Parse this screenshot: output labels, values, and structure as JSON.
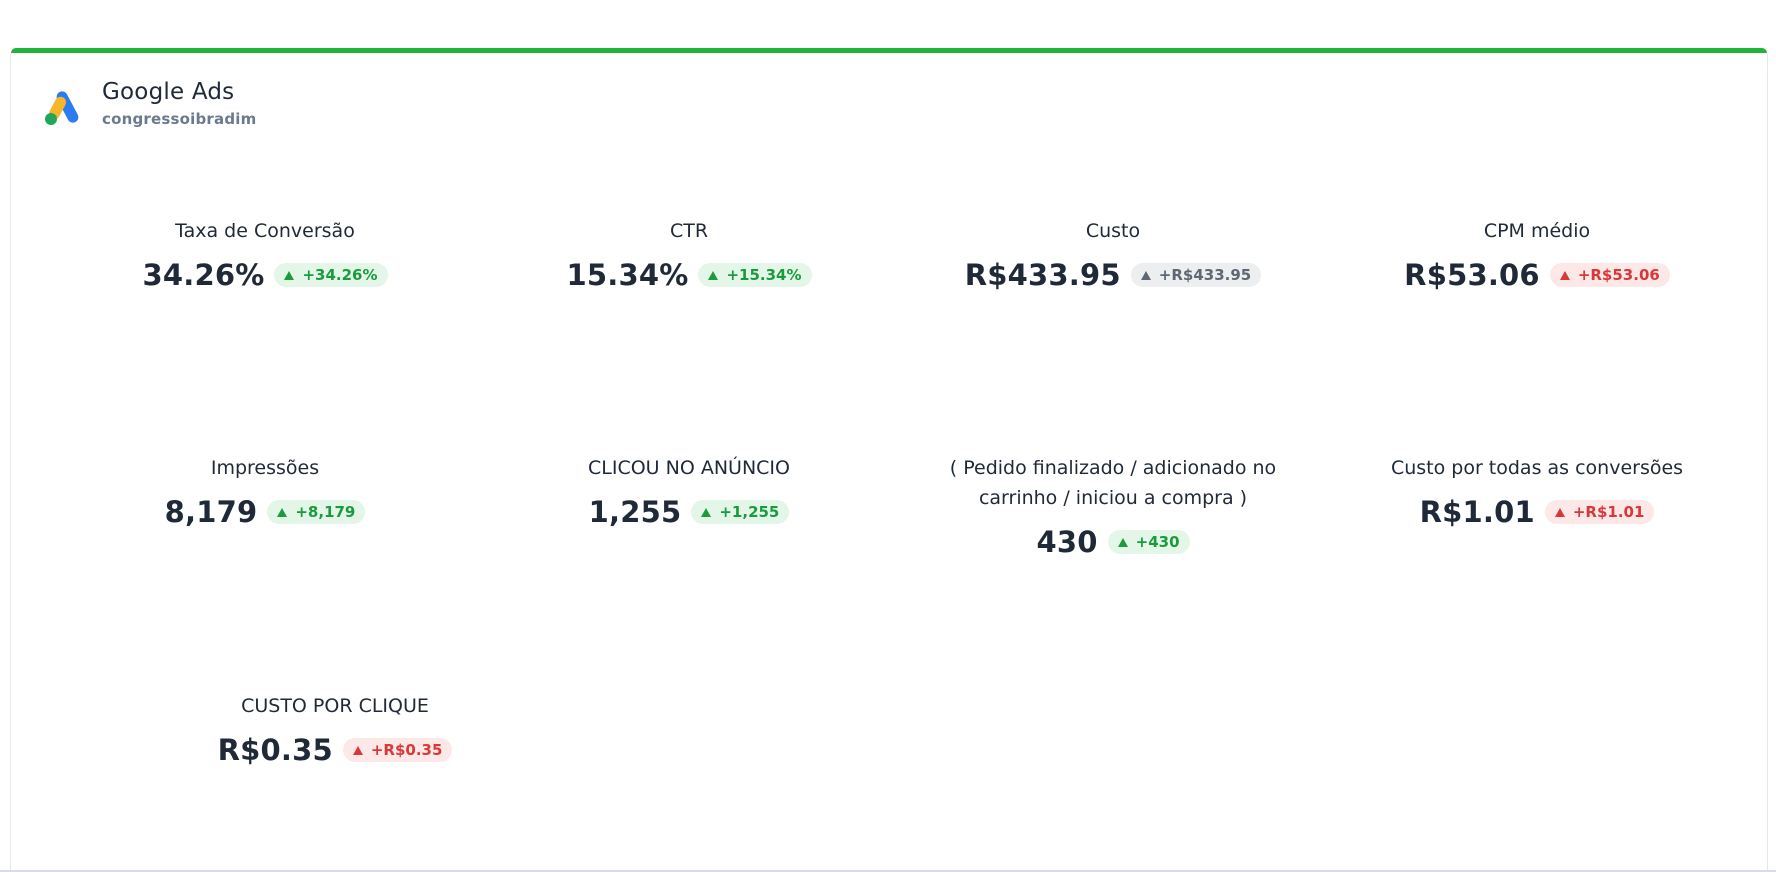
{
  "header": {
    "title": "Google Ads",
    "subtitle": "congressoibradim",
    "icon": "google-ads-logo-icon",
    "accent_color": "#1eb53a"
  },
  "metrics": [
    {
      "label": "Taxa de Conversão",
      "value": "34.26%",
      "change": "+34.26%",
      "trend": "green"
    },
    {
      "label": "CTR",
      "value": "15.34%",
      "change": "+15.34%",
      "trend": "green"
    },
    {
      "label": "Custo",
      "value": "R$433.95",
      "change": "+R$433.95",
      "trend": "gray"
    },
    {
      "label": "CPM médio",
      "value": "R$53.06",
      "change": "+R$53.06",
      "trend": "red"
    },
    {
      "label": "Impressões",
      "value": "8,179",
      "change": "+8,179",
      "trend": "green"
    },
    {
      "label": "CLICOU NO ANÚNCIO",
      "value": "1,255",
      "change": "+1,255",
      "trend": "green"
    },
    {
      "label": "( Pedido finalizado / adicionado no carrinho / iniciou a compra )",
      "value": "430",
      "change": "+430",
      "trend": "green"
    },
    {
      "label": "Custo por todas as conversões",
      "value": "R$1.01",
      "change": "+R$1.01",
      "trend": "red"
    },
    {
      "label": "CUSTO POR CLIQUE",
      "value": "R$0.35",
      "change": "+R$0.35",
      "trend": "red"
    }
  ],
  "colors": {
    "positive": "#1a9c3e",
    "negative": "#d93838",
    "neutral": "#5d6874"
  }
}
